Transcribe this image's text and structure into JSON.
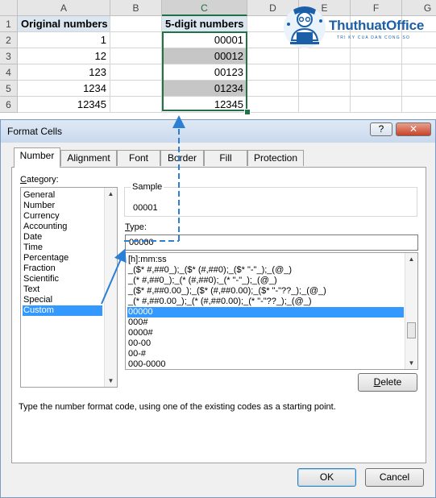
{
  "sheet": {
    "col_headers": [
      "A",
      "B",
      "C",
      "D",
      "E",
      "F",
      "G"
    ],
    "row_headers": [
      "1",
      "2",
      "3",
      "4",
      "5",
      "6"
    ],
    "a1": "Original numbers",
    "c1": "5-digit numbers",
    "original_numbers": [
      "1",
      "12",
      "123",
      "1234",
      "12345"
    ],
    "five_digit_numbers": [
      "00001",
      "00012",
      "00123",
      "01234",
      "12345"
    ],
    "selected_column": "C"
  },
  "logo": {
    "name": "ThuthuatOffice",
    "tagline": "TRI KY CUA DAN CONG SO",
    "icon": "office-worker-laptop-logo"
  },
  "dialog": {
    "title": "Format Cells",
    "help_label": "?",
    "close_label": "✕",
    "tabs": [
      "Number",
      "Alignment",
      "Font",
      "Border",
      "Fill",
      "Protection"
    ],
    "active_tab": "Number",
    "category_label": "Category:",
    "categories": [
      "General",
      "Number",
      "Currency",
      "Accounting",
      "Date",
      "Time",
      "Percentage",
      "Fraction",
      "Scientific",
      "Text",
      "Special",
      "Custom"
    ],
    "selected_category": "Custom",
    "sample_label": "Sample",
    "sample_value": "00001",
    "type_label": "Type:",
    "type_value": "00000",
    "formats": [
      "[h]:mm:ss",
      "_($* #,##0_);_($* (#,##0);_($* \"-\"_);_(@_)",
      "_(* #,##0_);_(* (#,##0);_(* \"-\"_);_(@_)",
      "_($* #,##0.00_);_($* (#,##0.00);_($* \"-\"??_);_(@_)",
      "_(* #,##0.00_);_(* (#,##0.00);_(* \"-\"??_);_(@_)",
      "00000",
      "000#",
      "0000#",
      "00-00",
      "00-#",
      "000-0000"
    ],
    "selected_format": "00000",
    "delete_label": "Delete",
    "hint": "Type the number format code, using one of the existing codes as a starting point.",
    "ok_label": "OK",
    "cancel_label": "Cancel"
  },
  "colors": {
    "excel_green": "#217346",
    "selection_blue": "#3399ff",
    "arrow_blue": "#2b7fd4",
    "header_fill": "#dce6f1",
    "selected_cell_fill": "#c6c6c6",
    "logo_blue": "#1b5fa8"
  }
}
